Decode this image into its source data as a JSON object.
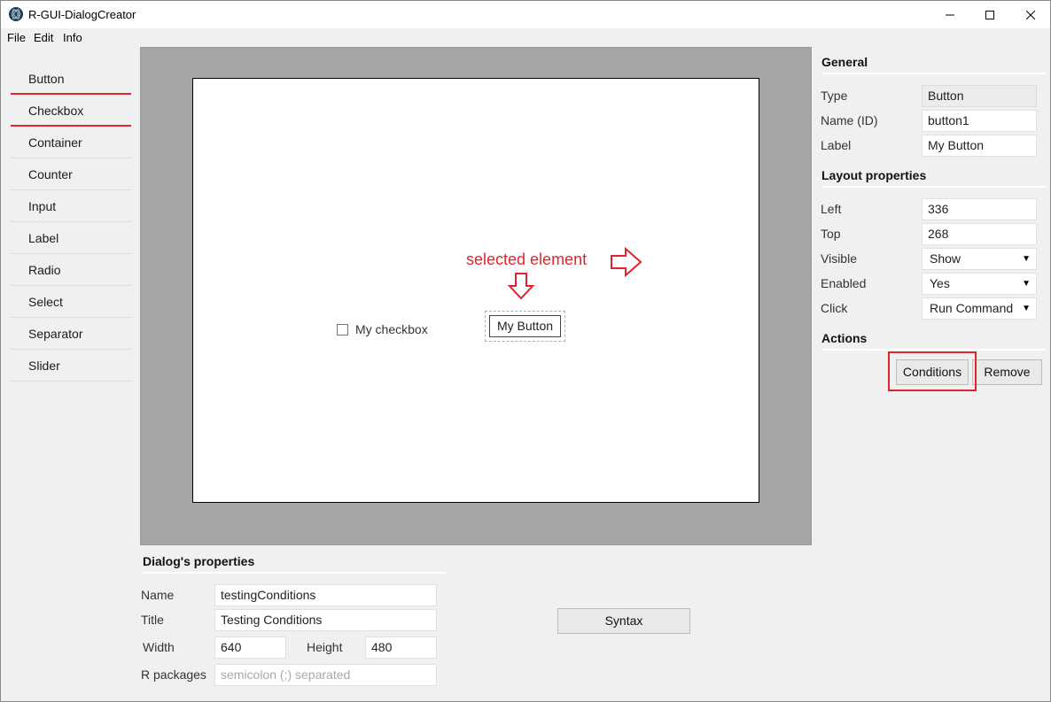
{
  "window": {
    "title": "R-GUI-DialogCreator",
    "controls": {
      "minimize": "minimize",
      "maximize": "maximize",
      "close": "close"
    }
  },
  "menu": [
    "File",
    "Edit",
    "Info"
  ],
  "sidebar": {
    "items": [
      {
        "label": "Button"
      },
      {
        "label": "Checkbox"
      },
      {
        "label": "Container"
      },
      {
        "label": "Counter"
      },
      {
        "label": "Input"
      },
      {
        "label": "Label"
      },
      {
        "label": "Radio"
      },
      {
        "label": "Select"
      },
      {
        "label": "Separator"
      },
      {
        "label": "Slider"
      }
    ],
    "marker_color": "#e0242d"
  },
  "canvas": {
    "checkbox_label": "My checkbox",
    "button_label": "My Button",
    "annotation": "selected element",
    "annotation_color": "#e0242d"
  },
  "general": {
    "title": "General",
    "type_label": "Type",
    "type_value": "Button",
    "name_label": "Name (ID)",
    "name_value": "button1",
    "label_label": "Label",
    "label_value": "My Button"
  },
  "layout": {
    "title": "Layout properties",
    "left_label": "Left",
    "left_value": "336",
    "top_label": "Top",
    "top_value": "268",
    "visible_label": "Visible",
    "visible_value": "Show",
    "enabled_label": "Enabled",
    "enabled_value": "Yes",
    "click_label": "Click",
    "click_value": "Run Command"
  },
  "actions": {
    "title": "Actions",
    "conditions": "Conditions",
    "remove": "Remove"
  },
  "dialog_props": {
    "title": "Dialog's properties",
    "name_label": "Name",
    "name_value": "testingConditions",
    "title_label": "Title",
    "title_value": "Testing Conditions",
    "width_label": "Width",
    "width_value": "640",
    "height_label": "Height",
    "height_value": "480",
    "packages_label": "R packages",
    "packages_placeholder": "semicolon (;) separated",
    "syntax_button": "Syntax"
  }
}
